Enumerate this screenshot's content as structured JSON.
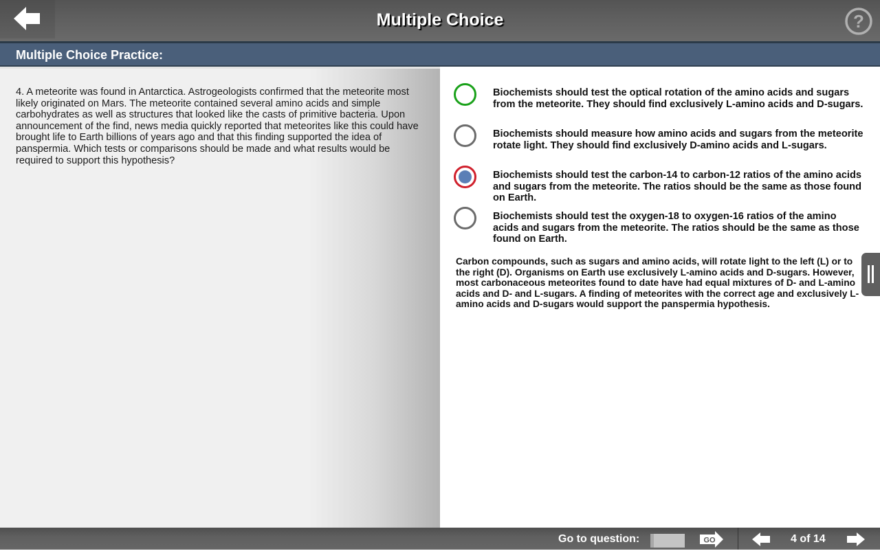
{
  "header": {
    "title": "Multiple Choice",
    "back_icon": "arrow-left-icon",
    "help_icon": "question-circle-icon"
  },
  "subheader": {
    "title": "Multiple Choice Practice:"
  },
  "question": {
    "number": 4,
    "text": "4. A meteorite was found in Antarctica. Astrogeologists confirmed that the meteorite most likely originated on Mars. The meteorite contained several amino acids and simple carbohydrates as well as structures that looked like the casts of primitive bacteria. Upon announcement of the find, news media quickly reported that meteorites like this could have brought life to Earth billions of years ago and that this finding supported the idea of panspermia. Which tests or comparisons should be made and what results would be required to support this hypothesis?"
  },
  "options": [
    {
      "text": "Biochemists should test the optical rotation of the amino acids and sugars from the meteorite. They should find exclusively L-amino acids and D-sugars.",
      "state": "correct"
    },
    {
      "text": "Biochemists should measure how amino acids and sugars from the meteorite rotate light. They should find exclusively D-amino acids and L-sugars.",
      "state": "unselected"
    },
    {
      "text": "Biochemists should test the carbon-14 to carbon-12 ratios of the amino acids and sugars from the meteorite. The ratios should be the same as those found on Earth.",
      "state": "selected-incorrect"
    },
    {
      "text": "Biochemists should test the oxygen-18 to oxygen-16 ratios of the amino acids and sugars from the meteorite. The ratios should be the same as those found on Earth.",
      "state": "unselected"
    }
  ],
  "explanation": "Carbon compounds, such as sugars and amino acids, will rotate light to the left (L) or to the right (D). Organisms on Earth use exclusively L-amino acids and D-sugars. However, most carbonaceous meteorites found to date have had equal mixtures of D- and L-amino acids and D- and L-sugars. A finding of meteorites with the correct age and exclusively L-amino acids and D-sugars would support the panspermia hypothesis.",
  "footer": {
    "goto_label": "Go to question:",
    "goto_value": "",
    "go_button_label": "GO",
    "page_indicator": "4 of 14",
    "prev_icon": "arrow-left-icon",
    "next_icon": "arrow-right-icon"
  },
  "colors": {
    "correct_ring": "#1aa11a",
    "selected_ring": "#d0202c",
    "selected_fill": "#5b7fb6",
    "subheader_bg": "#4a5f7a"
  }
}
